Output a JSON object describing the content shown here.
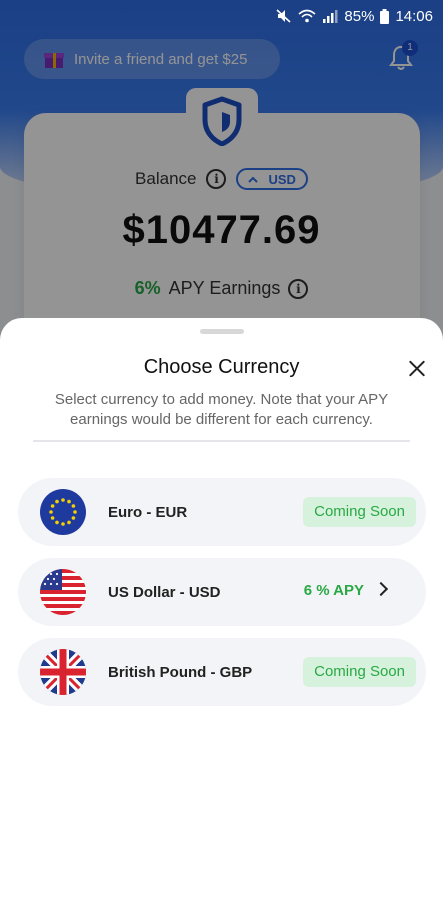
{
  "status_bar": {
    "battery": "85%",
    "time": "14:06"
  },
  "background": {
    "invite_text": "Invite a friend and get $25",
    "notification_count": "1",
    "balance_label": "Balance",
    "currency_chip": "USD",
    "balance_amount": "$10477.69",
    "apy_percent": "6%",
    "apy_label": "APY Earnings"
  },
  "sheet": {
    "title": "Choose Currency",
    "subtitle": "Select currency to add money. Note that your APY earnings would be different for each currency.",
    "currencies": [
      {
        "name": "Euro - EUR",
        "status": "Coming Soon",
        "flag": "eu-flag-icon"
      },
      {
        "name": "US Dollar - USD",
        "apy": "6 % APY",
        "flag": "us-flag-icon"
      },
      {
        "name": "British Pound - GBP",
        "status": "Coming Soon",
        "flag": "uk-flag-icon"
      }
    ]
  },
  "colors": {
    "brand_blue": "#2f6ee6",
    "apy_green": "#2aa845",
    "badge_green_bg": "#d6f2dc"
  }
}
